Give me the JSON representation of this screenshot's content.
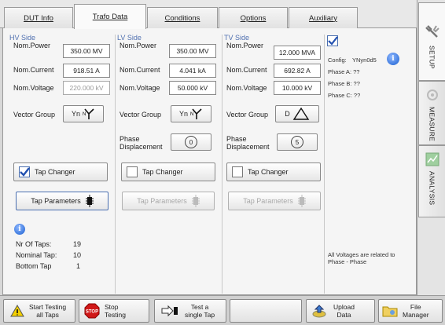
{
  "tabs": [
    "DUT Info",
    "Trafo Data",
    "Conditions",
    "Options",
    "Auxiliary"
  ],
  "side_tabs": [
    "SETUP",
    "MEASURE",
    "ANALYSIS"
  ],
  "labels": {
    "nom_power": "Nom.Power",
    "nom_current": "Nom.Current",
    "nom_voltage": "Nom.Voltage",
    "vector_group": "Vector Group",
    "phase_disp_1": "Phase",
    "phase_disp_2": "Displacement",
    "tap_changer": "Tap Changer",
    "tap_parameters": "Tap Parameters"
  },
  "hv": {
    "title": "HV Side",
    "power": "350.00 MV",
    "current": "918.51 A",
    "voltage": "220.000 kV",
    "vg": "Yn",
    "tap_checked": true
  },
  "lv": {
    "title": "LV Side",
    "power": "350.00 MV",
    "current": "4.041 kA",
    "voltage": "50.000 kV",
    "vg": "Yn",
    "phase": "0",
    "tap_checked": false
  },
  "tv": {
    "title": "TV Side",
    "power": "12.000 MVA",
    "current": "692.82 A",
    "voltage": "10.000 kV",
    "vg": "D",
    "phase": "5",
    "tap_checked": false
  },
  "taps": {
    "nr_label": "Nr Of Taps:",
    "nr_value": "19",
    "nominal_label": "Nominal Tap:",
    "nominal_value": "10",
    "bottom_label": "Bottom Tap",
    "bottom_value": "1"
  },
  "config": {
    "label": "Config:",
    "value": "YNyn0d5",
    "phase_a": "Phase A: ??",
    "phase_b": "Phase B: ??",
    "phase_c": "Phase C: ??",
    "note": "All Voltages are related to Phase - Phase"
  },
  "bottom": {
    "start_1": "Start Testing",
    "start_2": "all Taps",
    "stop_1": "Stop",
    "stop_2": "Testing",
    "test_1": "Test a",
    "test_2": "single Tap",
    "upload_1": "Upload",
    "upload_2": "Data",
    "file_1": "File",
    "file_2": "Manager",
    "stop_badge": "STOP"
  },
  "colors": {
    "accent_blue": "#1a5fd0",
    "stop_red": "#d01818",
    "warn_yellow": "#f4d000"
  }
}
